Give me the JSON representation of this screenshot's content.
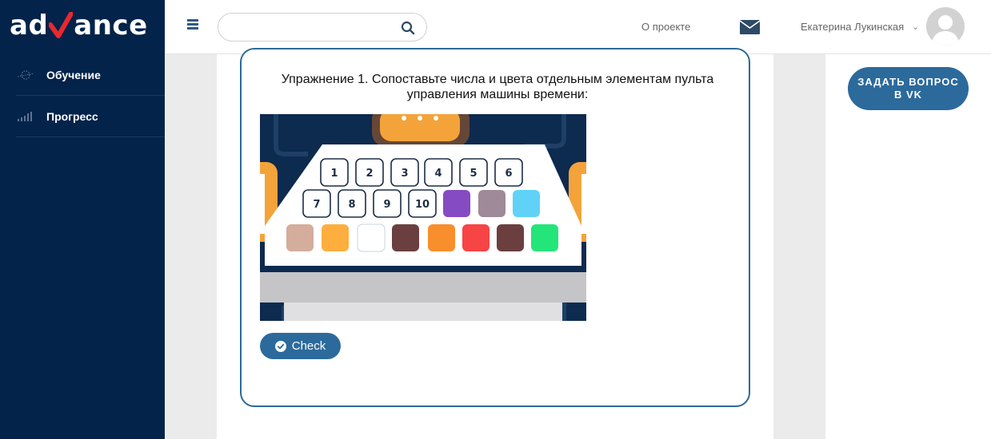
{
  "logo": {
    "left": "ad",
    "right": "ance"
  },
  "sidebar": {
    "items": [
      {
        "label": "Обучение"
      },
      {
        "label": "Прогресс"
      }
    ]
  },
  "header": {
    "search_placeholder": "",
    "about_label": "О проекте",
    "user_name": "Екатерина Лукинская",
    "chevron": "⌄"
  },
  "exercise": {
    "title": "Упражнение 1. Сопоставьте числа и цвета отдельным элементам пульта управления машины времени:",
    "number_tiles": [
      "1",
      "2",
      "3",
      "4",
      "5",
      "6",
      "7",
      "8",
      "9",
      "10"
    ],
    "color_tiles_row2": [
      "#854bc2",
      "#9e8a99",
      "#60d2f8"
    ],
    "color_tiles_row3": [
      "#d4ad9c",
      "#fdae3f",
      "#ffffff",
      "#6b3f40",
      "#f98e2c",
      "#f74445",
      "#6b3f40",
      "#24e57a"
    ],
    "check_label": "Check"
  },
  "right_panel": {
    "vk_button_label": "ЗАДАТЬ ВОПРОС В VK"
  },
  "colors": {
    "sidebar_bg": "#04234a",
    "accent": "#2c6a9c",
    "logo_check": "#e8282f",
    "machine_bg": "#0d2a4f"
  }
}
